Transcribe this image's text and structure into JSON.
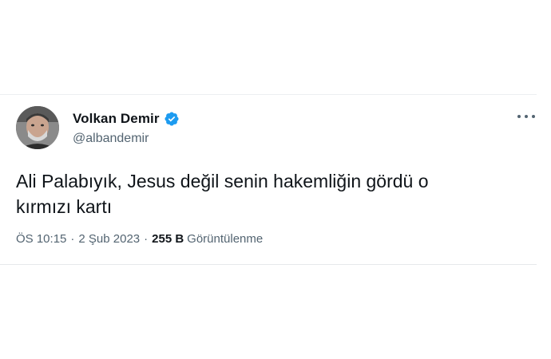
{
  "tweet": {
    "author": {
      "name": "Volkan Demir",
      "handle": "@albandemir",
      "verified": true
    },
    "text": "Ali Palabıyık, Jesus değil senin hakemliğin gördü o\nkırmızı kartı",
    "meta": {
      "time": "ÖS 10:15",
      "separator": "·",
      "date": "2 Şub 2023",
      "views_count": "255 B",
      "views_label": "Görüntülenme"
    },
    "more_icon": "more-horizontal-icon"
  },
  "colors": {
    "text_primary": "#0f1419",
    "text_secondary": "#536471",
    "verified_blue": "#1d9bf0",
    "border": "#eceff1"
  }
}
